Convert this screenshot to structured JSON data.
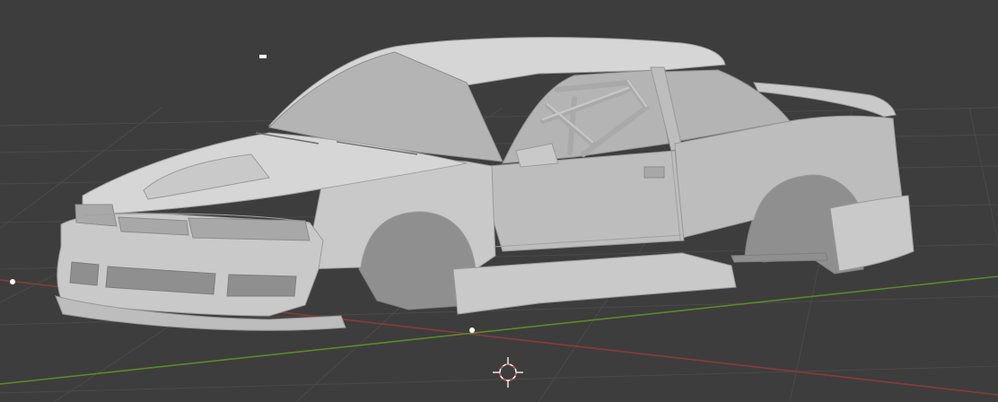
{
  "viewport": {
    "background_color": "#3d3d3d",
    "grid_color": "#4a4a4a",
    "x_axis_color": "#8a3a3c",
    "y_axis_color": "#5a8a28",
    "model_color": "#c9c9c9",
    "shading": "solid"
  },
  "scene": {
    "object": "car-body-model",
    "icons": [
      "3d-cursor-icon",
      "origin-dot-icon"
    ]
  }
}
